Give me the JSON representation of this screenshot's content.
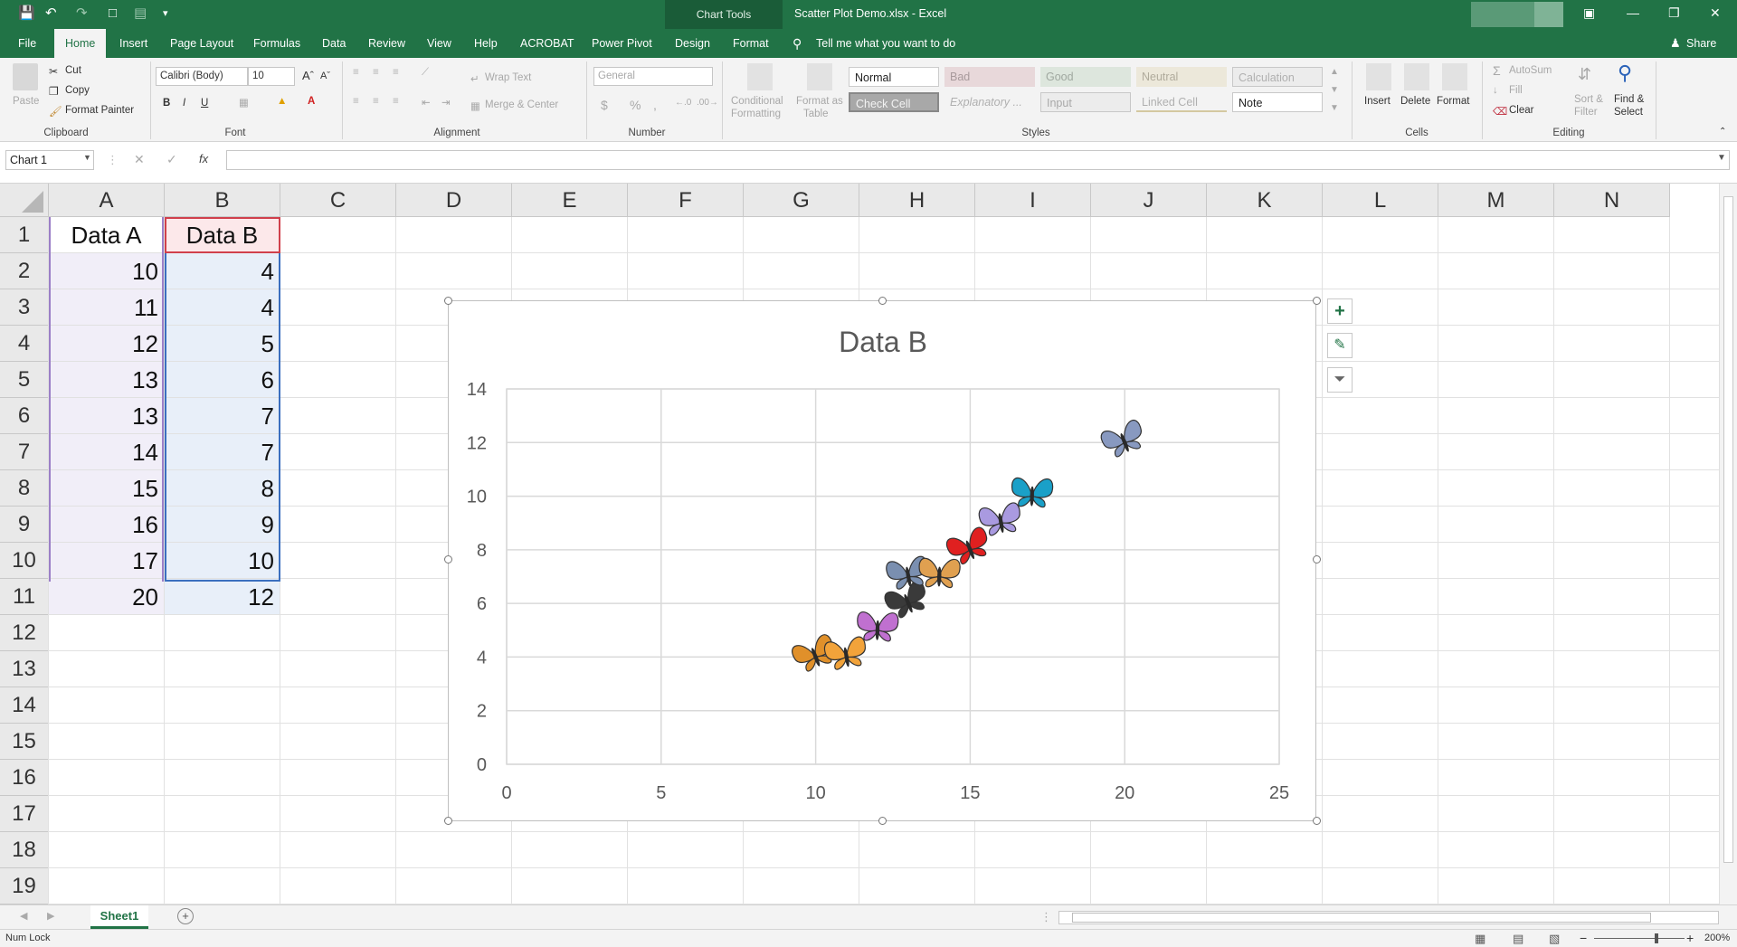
{
  "window": {
    "chart_tools": "Chart Tools",
    "doc_title": "Scatter Plot Demo.xlsx  -  Excel"
  },
  "tabs": [
    "File",
    "Home",
    "Insert",
    "Page Layout",
    "Formulas",
    "Data",
    "Review",
    "View",
    "Help",
    "ACROBAT",
    "Power Pivot",
    "Design",
    "Format"
  ],
  "tellme": "Tell me what you want to do",
  "share": "Share",
  "ribbon": {
    "clipboard": {
      "paste": "Paste",
      "cut": "Cut",
      "copy": "Copy",
      "format_painter": "Format Painter",
      "label": "Clipboard"
    },
    "font": {
      "name": "Calibri (Body)",
      "size": "10",
      "label": "Font",
      "bold": "B",
      "italic": "I",
      "underline": "U"
    },
    "alignment": {
      "wrap": "Wrap Text",
      "merge": "Merge & Center",
      "label": "Alignment"
    },
    "number": {
      "format": "General",
      "label": "Number",
      "currency": "$",
      "percent": "%",
      "comma": ","
    },
    "styles": {
      "conditional": "Conditional",
      "formatting": "Formatting",
      "format_as": "Format as",
      "table": "Table",
      "normal": "Normal",
      "bad": "Bad",
      "good": "Good",
      "neutral": "Neutral",
      "calculation": "Calculation",
      "check_cell": "Check Cell",
      "explanatory": "Explanatory ...",
      "input": "Input",
      "linked_cell": "Linked Cell",
      "note": "Note",
      "label": "Styles"
    },
    "cells": {
      "insert": "Insert",
      "delete": "Delete",
      "format": "Format",
      "label": "Cells"
    },
    "editing": {
      "autosum": "AutoSum",
      "fill": "Fill",
      "clear": "Clear",
      "sort": "Sort &",
      "filter": "Filter",
      "find": "Find &",
      "select": "Select",
      "label": "Editing"
    }
  },
  "formula_bar": {
    "name_box": "Chart 1",
    "fx": "fx",
    "value": ""
  },
  "columns": [
    "A",
    "B",
    "C",
    "D",
    "E",
    "F",
    "G",
    "H",
    "I",
    "J",
    "K",
    "L",
    "M",
    "N"
  ],
  "rows": [
    "1",
    "2",
    "3",
    "4",
    "5",
    "6",
    "7",
    "8",
    "9",
    "10",
    "11",
    "12",
    "13",
    "14",
    "15",
    "16",
    "17",
    "18",
    "19"
  ],
  "table": {
    "headers": [
      "Data A",
      "Data B"
    ],
    "data_a": [
      "10",
      "11",
      "12",
      "13",
      "13",
      "14",
      "15",
      "16",
      "17",
      "20"
    ],
    "data_b": [
      "4",
      "4",
      "5",
      "6",
      "7",
      "7",
      "8",
      "9",
      "10",
      "12"
    ]
  },
  "chart_data": {
    "type": "scatter",
    "title": "Data B",
    "x": [
      10,
      11,
      12,
      13,
      13,
      14,
      15,
      16,
      17,
      20
    ],
    "y": [
      4,
      4,
      5,
      6,
      7,
      7,
      8,
      9,
      10,
      12
    ],
    "xlim": [
      0,
      25
    ],
    "ylim": [
      0,
      14
    ],
    "xticks": [
      "0",
      "5",
      "10",
      "15",
      "20",
      "25"
    ],
    "yticks": [
      "0",
      "2",
      "4",
      "6",
      "8",
      "10",
      "12",
      "14"
    ],
    "grid": true,
    "marker": "butterfly-icon",
    "marker_colors": [
      "#e0902a",
      "#f2a33a",
      "#c070d0",
      "#3a3a3a",
      "#7a8fb0",
      "#e0a050",
      "#e02020",
      "#a99ae0",
      "#1aa0c8",
      "#8899c0"
    ]
  },
  "sheet_tabs": [
    "Sheet1"
  ],
  "status": {
    "num_lock": "Num Lock",
    "zoom": "200%"
  }
}
